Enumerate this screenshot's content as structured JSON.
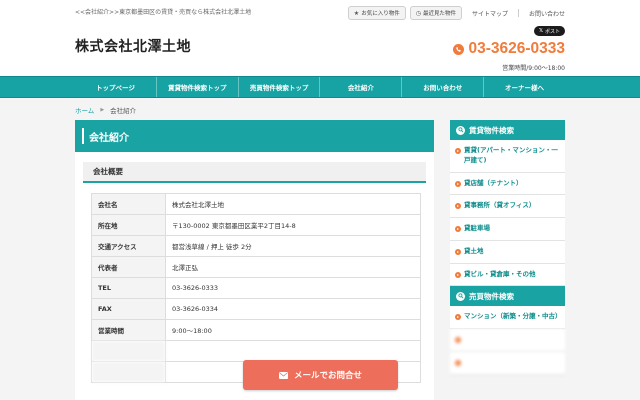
{
  "header": {
    "tagline": "<<会社紹介>>東京都墨田区の賃貸・売買なら株式会社北澤土地",
    "favorite_label": "お気に入り物件",
    "recent_label": "最近見た物件",
    "sitemap_label": "サイトマップ",
    "contact_label": "お問い合わせ",
    "logo": "株式会社北澤土地",
    "x_post_label": "ポスト",
    "phone": "03-3626-0333",
    "hours": "営業時間/9:00〜18:00"
  },
  "nav": {
    "items": [
      {
        "label": "トップページ"
      },
      {
        "label": "賃貸物件検索トップ"
      },
      {
        "label": "売買物件検索トップ"
      },
      {
        "label": "会社紹介"
      },
      {
        "label": "お問い合わせ"
      },
      {
        "label": "オーナー様へ"
      }
    ]
  },
  "breadcrumb": {
    "home": "ホーム",
    "current": "会社紹介"
  },
  "main": {
    "title": "会社紹介",
    "section_title": "会社概要",
    "rows": [
      {
        "key": "会社名",
        "value": "株式会社北澤土地"
      },
      {
        "key": "所在地",
        "value": "〒130-0002 東京都墨田区業平2丁目14-8"
      },
      {
        "key": "交通アクセス",
        "value": "都営浅草線 / 押上 徒歩 2分"
      },
      {
        "key": "代表者",
        "value": "北澤正弘"
      },
      {
        "key": "TEL",
        "value": "03-3626-0333"
      },
      {
        "key": "FAX",
        "value": "03-3626-0334"
      },
      {
        "key": "営業時間",
        "value": "9:00〜18:00"
      }
    ]
  },
  "sidebar": {
    "rent_title": "賃貸物件検索",
    "rent_items": [
      {
        "label": "賃貸(アパート・マンション・一戸建て)"
      },
      {
        "label": "貸店舗（テナント）"
      },
      {
        "label": "貸事務所（貸オフィス）"
      },
      {
        "label": "貸駐車場"
      },
      {
        "label": "貸土地"
      },
      {
        "label": "貸ビル・貸倉庫・その他"
      }
    ],
    "sale_title": "売買物件検索",
    "sale_items": [
      {
        "label": "マンション（新築・分譲・中古）"
      }
    ]
  },
  "floating": {
    "mail_label": "メールでお問合せ"
  },
  "colors": {
    "accent": "#1aa3a3",
    "phone": "#f07b3a",
    "mail_button": "#ec6e5b"
  }
}
